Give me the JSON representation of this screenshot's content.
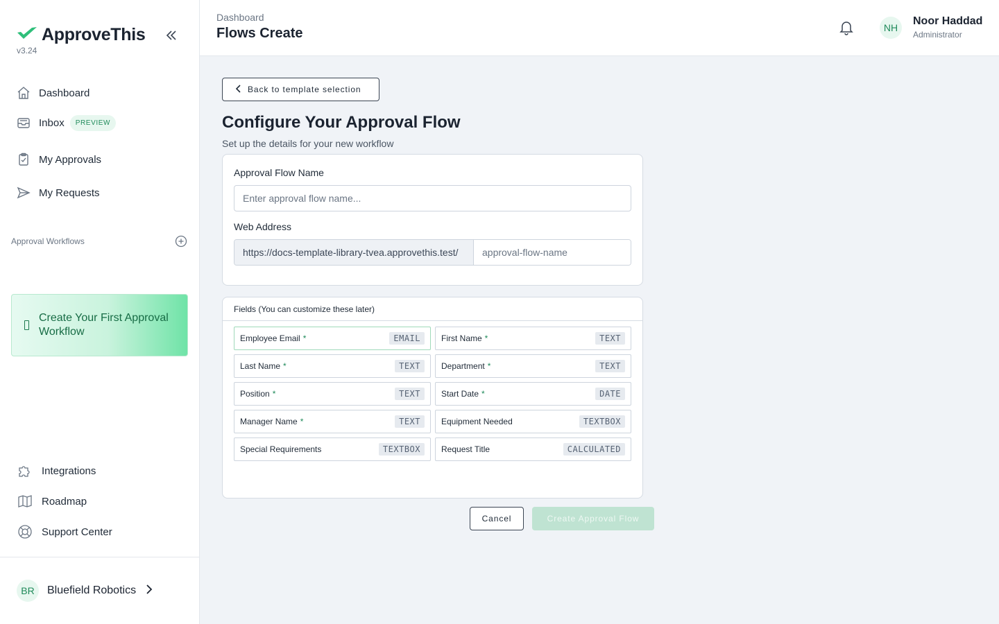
{
  "app": {
    "brand_name": "ApproveThis",
    "version": "v3.24",
    "accent_color": "#1f8a5a"
  },
  "sidebar": {
    "nav": [
      {
        "label": "Dashboard",
        "icon": "home-icon"
      },
      {
        "label": "Inbox",
        "icon": "inbox-icon",
        "badge": "PREVIEW"
      },
      {
        "label": "My Approvals",
        "icon": "clipboard-check-icon"
      },
      {
        "label": "My Requests",
        "icon": "send-icon"
      }
    ],
    "workflows_label": "Approval Workflows",
    "cta_label": "Create Your First Approval Workflow",
    "bottom_nav": [
      {
        "label": "Integrations",
        "icon": "puzzle-icon"
      },
      {
        "label": "Roadmap",
        "icon": "map-icon"
      },
      {
        "label": "Support Center",
        "icon": "lifebuoy-icon"
      }
    ],
    "org": {
      "initials": "BR",
      "name": "Bluefield Robotics"
    }
  },
  "header": {
    "breadcrumb": "Dashboard",
    "title": "Flows Create",
    "user": {
      "initials": "NH",
      "name": "Noor Haddad",
      "role": "Administrator"
    }
  },
  "main": {
    "back_label": "Back to template selection",
    "heading": "Configure Your Approval Flow",
    "subheading": "Set up the details for your new workflow",
    "form": {
      "name_label": "Approval Flow Name",
      "name_placeholder": "Enter approval flow name...",
      "name_value": "",
      "web_label": "Web Address",
      "url_prefix": "https://docs-template-library-tvea.approvethis.test/",
      "slug_placeholder": "approval-flow-name",
      "slug_value": ""
    },
    "fields_header": "Fields (You can customize these later)",
    "fields": [
      {
        "name": "Employee Email",
        "required": "*",
        "type": "EMAIL"
      },
      {
        "name": "First Name",
        "required": "*",
        "type": "TEXT"
      },
      {
        "name": "Last Name",
        "required": "*",
        "type": "TEXT"
      },
      {
        "name": "Department",
        "required": "*",
        "type": "TEXT"
      },
      {
        "name": "Position",
        "required": "*",
        "type": "TEXT"
      },
      {
        "name": "Start Date",
        "required": "*",
        "type": "DATE"
      },
      {
        "name": "Manager Name",
        "required": "*",
        "type": "TEXT"
      },
      {
        "name": "Equipment Needed",
        "required": "",
        "type": "TEXTBOX"
      },
      {
        "name": "Special Requirements",
        "required": "",
        "type": "TEXTBOX"
      },
      {
        "name": "Request Title",
        "required": "",
        "type": "CALCULATED"
      }
    ],
    "cancel_label": "Cancel",
    "create_label": "Create Approval Flow"
  }
}
